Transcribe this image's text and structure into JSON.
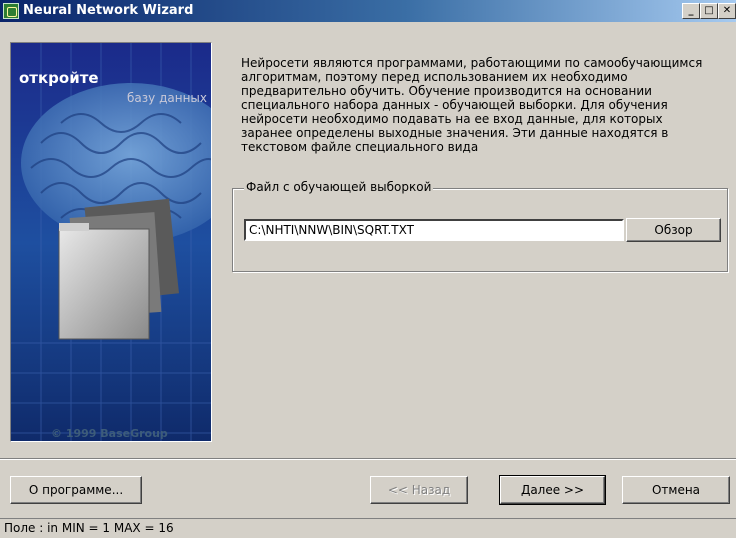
{
  "window": {
    "title": "Neural Network Wizard",
    "controls": {
      "minimize": "_",
      "maximize": "□",
      "close": "✕"
    }
  },
  "banner": {
    "title": "откройте",
    "subtitle": "базу данных",
    "copyright": "© 1999 BaseGroup"
  },
  "main": {
    "description": "Нейросети являются программами, работающими по самообучающимся алгоритмам, поэтому перед использованием их необходимо предварительно обучить. Обучение производится на основании специального набора данных - обучающей выборки. Для обучения нейросети необходимо подавать на ее вход данные, для которых заранее определены выходные значения. Эти данные находятся в текстовом файле специального вида",
    "group_label": "Файл с обучающей выборкой",
    "file_path": "C:\\NHTI\\NNW\\BIN\\SQRT.TXT",
    "browse_label": "Обзор"
  },
  "buttons": {
    "about": "О программе...",
    "back": "<< Назад",
    "next": "Далее >>",
    "cancel": "Отмена"
  },
  "status": {
    "text": "Поле : in  MIN = 1 MAX = 16"
  },
  "colors": {
    "titlebar_start": "#0a246a",
    "titlebar_end": "#a6caf0",
    "dialog_bg": "#d4d0c8"
  }
}
